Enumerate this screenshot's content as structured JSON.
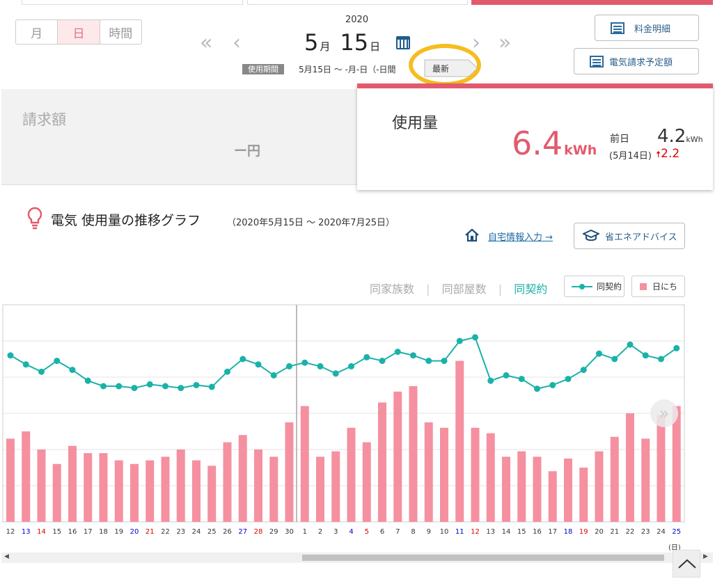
{
  "tabs": {
    "month": "月",
    "day": "日",
    "hour": "時間"
  },
  "date": {
    "year": "2020",
    "month": "5",
    "month_unit": "月",
    "day": "15",
    "day_unit": "日"
  },
  "period": {
    "badge": "使用期間",
    "text": "5月15日 ～ -月-日（-日間",
    "latest": "最新"
  },
  "buttons": {
    "fee_detail": "料金明細",
    "bill_forecast": "電気請求予定額",
    "home_info": "自宅情報入力 →",
    "eco_advice": "省エネアドバイス"
  },
  "billing": {
    "label": "請求額",
    "amount": "ー円"
  },
  "usage": {
    "label": "使用量",
    "value": "6.4",
    "unit": "kWh",
    "prev_label": "前日",
    "prev_date": "(5月14日)",
    "prev_value": "4.2",
    "prev_unit": "kWh",
    "diff": "2.2"
  },
  "graph": {
    "title": "電気 使用量の推移グラフ",
    "range": "（2020年5月15日 ～ 2020年7月25日）",
    "compare_family": "同家族数",
    "compare_rooms": "同部屋数",
    "compare_contract": "同契約",
    "legend_line": "同契約",
    "legend_bar": "日にち",
    "day_suffix": "(日)"
  },
  "colors": {
    "accent": "#e25a6d",
    "bar": "#f590a0",
    "line": "#1ab2a8",
    "blue": "#0000cc",
    "red": "#dd0000"
  },
  "chart_data": {
    "type": "bar",
    "categories": [
      "12",
      "13",
      "14",
      "15",
      "16",
      "17",
      "18",
      "19",
      "20",
      "21",
      "22",
      "23",
      "24",
      "25",
      "26",
      "27",
      "28",
      "29",
      "30",
      "1",
      "2",
      "3",
      "4",
      "5",
      "6",
      "7",
      "8",
      "9",
      "10",
      "11",
      "12",
      "13",
      "14",
      "15",
      "16",
      "17",
      "18",
      "19",
      "20",
      "21",
      "22",
      "23",
      "24",
      "25"
    ],
    "category_colors": [
      "normal",
      "blue",
      "red",
      "normal",
      "normal",
      "normal",
      "normal",
      "normal",
      "blue",
      "red",
      "normal",
      "normal",
      "normal",
      "normal",
      "normal",
      "blue",
      "red",
      "normal",
      "normal",
      "normal",
      "normal",
      "normal",
      "blue",
      "red",
      "normal",
      "normal",
      "normal",
      "normal",
      "normal",
      "blue",
      "red",
      "normal",
      "normal",
      "normal",
      "normal",
      "normal",
      "blue",
      "red",
      "normal",
      "normal",
      "normal",
      "normal",
      "normal",
      "blue"
    ],
    "series": [
      {
        "name": "日にち",
        "type": "bar",
        "values": [
          2.3,
          2.5,
          2.0,
          1.6,
          2.1,
          1.9,
          1.9,
          1.7,
          1.6,
          1.7,
          1.8,
          2.0,
          1.7,
          1.55,
          2.2,
          2.4,
          2.0,
          1.8,
          2.75,
          3.2,
          1.8,
          1.95,
          2.6,
          2.2,
          3.3,
          3.6,
          3.75,
          2.75,
          2.6,
          4.45,
          2.6,
          2.45,
          1.8,
          1.95,
          1.8,
          1.4,
          1.75,
          1.5,
          1.95,
          2.35,
          3.0,
          2.3,
          2.95,
          3.2
        ]
      },
      {
        "name": "同契約",
        "type": "line",
        "values": [
          4.6,
          4.35,
          4.15,
          4.45,
          4.2,
          3.9,
          3.75,
          3.75,
          3.7,
          3.8,
          3.75,
          3.7,
          3.78,
          3.73,
          4.15,
          4.5,
          4.35,
          4.05,
          4.3,
          4.4,
          4.3,
          4.1,
          4.3,
          4.55,
          4.45,
          4.7,
          4.6,
          4.45,
          4.45,
          5.0,
          5.1,
          3.9,
          4.05,
          3.95,
          3.68,
          3.78,
          3.95,
          4.2,
          4.65,
          4.5,
          4.9,
          4.6,
          4.5,
          4.8
        ]
      }
    ],
    "ylim": [
      0,
      6
    ],
    "grid": true,
    "legend": "top-right"
  }
}
